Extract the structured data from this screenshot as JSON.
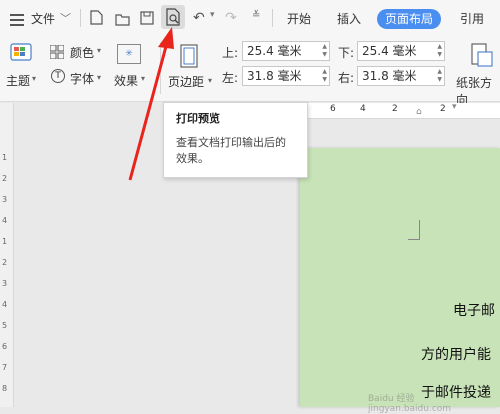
{
  "titlebar": {
    "file_menu": "文件",
    "tabs": [
      {
        "label": "开始"
      },
      {
        "label": "插入"
      },
      {
        "label": "页面布局",
        "active": true
      },
      {
        "label": "引用"
      }
    ]
  },
  "ribbon": {
    "theme_label": "主题",
    "color_label": "颜色",
    "font_label": "字体",
    "effect_label": "效果",
    "margin_label": "页边距",
    "orientation_label": "纸张方向",
    "margins": {
      "top_label": "上:",
      "top_value": "25.4 毫米",
      "bottom_label": "下:",
      "bottom_value": "25.4 毫米",
      "left_label": "左:",
      "left_value": "31.8 毫米",
      "right_label": "右:",
      "right_value": "31.8 毫米"
    }
  },
  "tooltip": {
    "title": "打印预览",
    "description_line1": "查看文档打印输出后的",
    "description_line2": "效果。"
  },
  "ruler": {
    "h_ticks": [
      "6",
      "4",
      "2",
      "2"
    ],
    "v_ticks": [
      "1",
      "2",
      "3",
      "4",
      "1",
      "2",
      "3",
      "4",
      "5",
      "6",
      "7",
      "8"
    ]
  },
  "document": {
    "line1": "电子邮",
    "line2": "方的用户能",
    "line3": "于邮件投递"
  },
  "watermark": "Baidu 经验 jingyan.baidu.com",
  "colors": {
    "accent": "#4a8ef0",
    "page_bg": "#c8e3b8",
    "arrow": "#e8241c"
  }
}
